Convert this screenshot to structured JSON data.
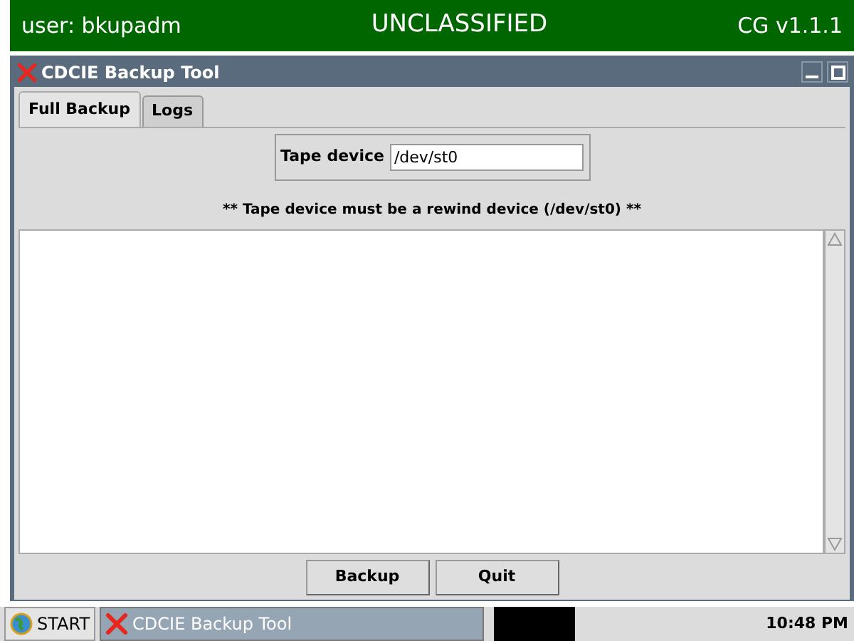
{
  "top_bar": {
    "user": "user: bkupadm",
    "classification": "UNCLASSIFIED",
    "version": "CG v1.1.1"
  },
  "window": {
    "title": "CDCIE Backup Tool"
  },
  "tabs": [
    {
      "label": "Full Backup",
      "selected": true
    },
    {
      "label": "Logs",
      "selected": false
    }
  ],
  "tape_device": {
    "label": "Tape device",
    "value": "/dev/st0"
  },
  "note": "** Tape device must be a rewind device (/dev/st0) **",
  "buttons": [
    "Backup",
    "Quit"
  ],
  "taskbar": {
    "start": "START",
    "task": "CDCIE Backup Tool",
    "clock": "10:48 PM"
  }
}
